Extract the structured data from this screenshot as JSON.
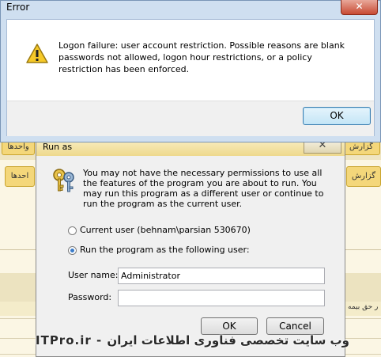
{
  "error_dialog": {
    "title": "Error",
    "close_label": "✕",
    "message": "Logon failure: user account restriction. Possible reasons are blank passwords not allowed, logon hour restrictions, or a policy restriction has been enforced.",
    "ok_label": "OK",
    "icon": "warning-icon"
  },
  "runas_dialog": {
    "title": "Run as",
    "close_label": "✕",
    "icon": "keys-icon",
    "message": "You may not have the necessary permissions to use all the features of the program you are about to run. You may run this program as a different user or continue to run the program as the current user.",
    "option_current": "Current user (behnam\\parsian 530670)",
    "option_other": "Run the program as the following user:",
    "selected_option": "other",
    "username_label": "User name:",
    "username_value": "Administrator",
    "password_label": "Password:",
    "password_value": "",
    "ok_label": "OK",
    "cancel_label": "Cancel"
  },
  "background_app": {
    "tab_left_1": "واحدها",
    "tab_right_1": "گزارش",
    "tab_left_2": "احدها",
    "tab_right_2": "گزارش",
    "cell_right": "ر حق بیمه"
  },
  "watermark": "ITPro.ir - وب سایت تخصصی فناوری اطلاعات ایران"
}
